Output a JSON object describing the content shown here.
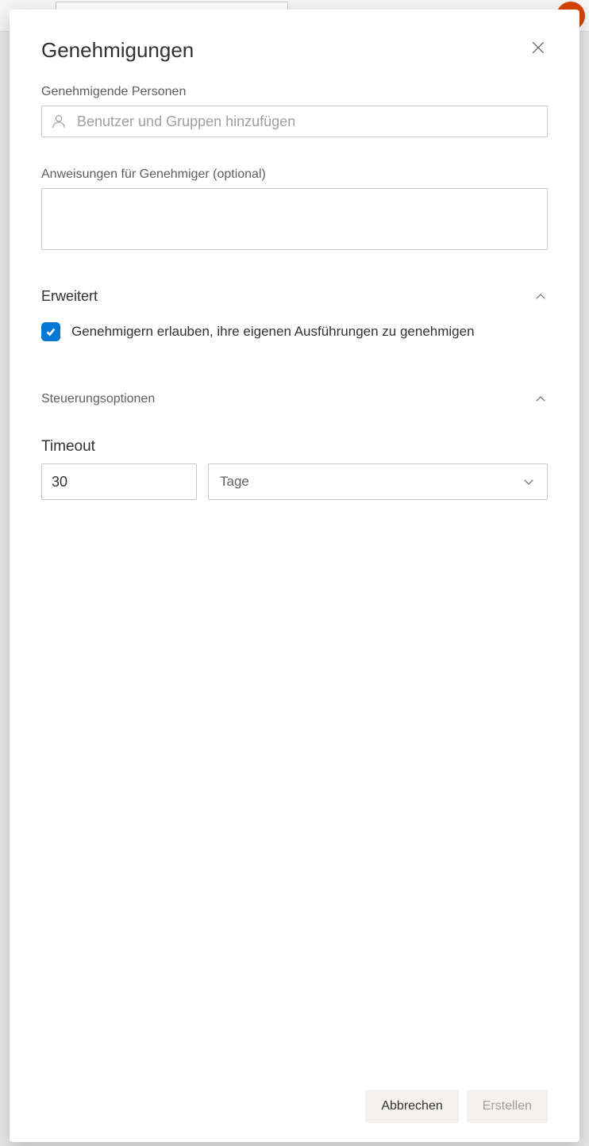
{
  "modal": {
    "title": "Genehmigungen"
  },
  "approvers": {
    "label": "Genehmigende Personen",
    "placeholder": "Benutzer und Gruppen hinzufügen"
  },
  "instructions": {
    "label": "Anweisungen für Genehmiger (optional)",
    "value": ""
  },
  "advanced": {
    "title": "Erweitert",
    "checkbox_label": "Genehmigern erlauben, ihre eigenen Ausführungen zu genehmigen",
    "checked": true
  },
  "control": {
    "title": "Steuerungsoptionen",
    "timeout_label": "Timeout",
    "timeout_value": "30",
    "timeout_unit": "Tage"
  },
  "footer": {
    "cancel": "Abbrechen",
    "create": "Erstellen"
  }
}
